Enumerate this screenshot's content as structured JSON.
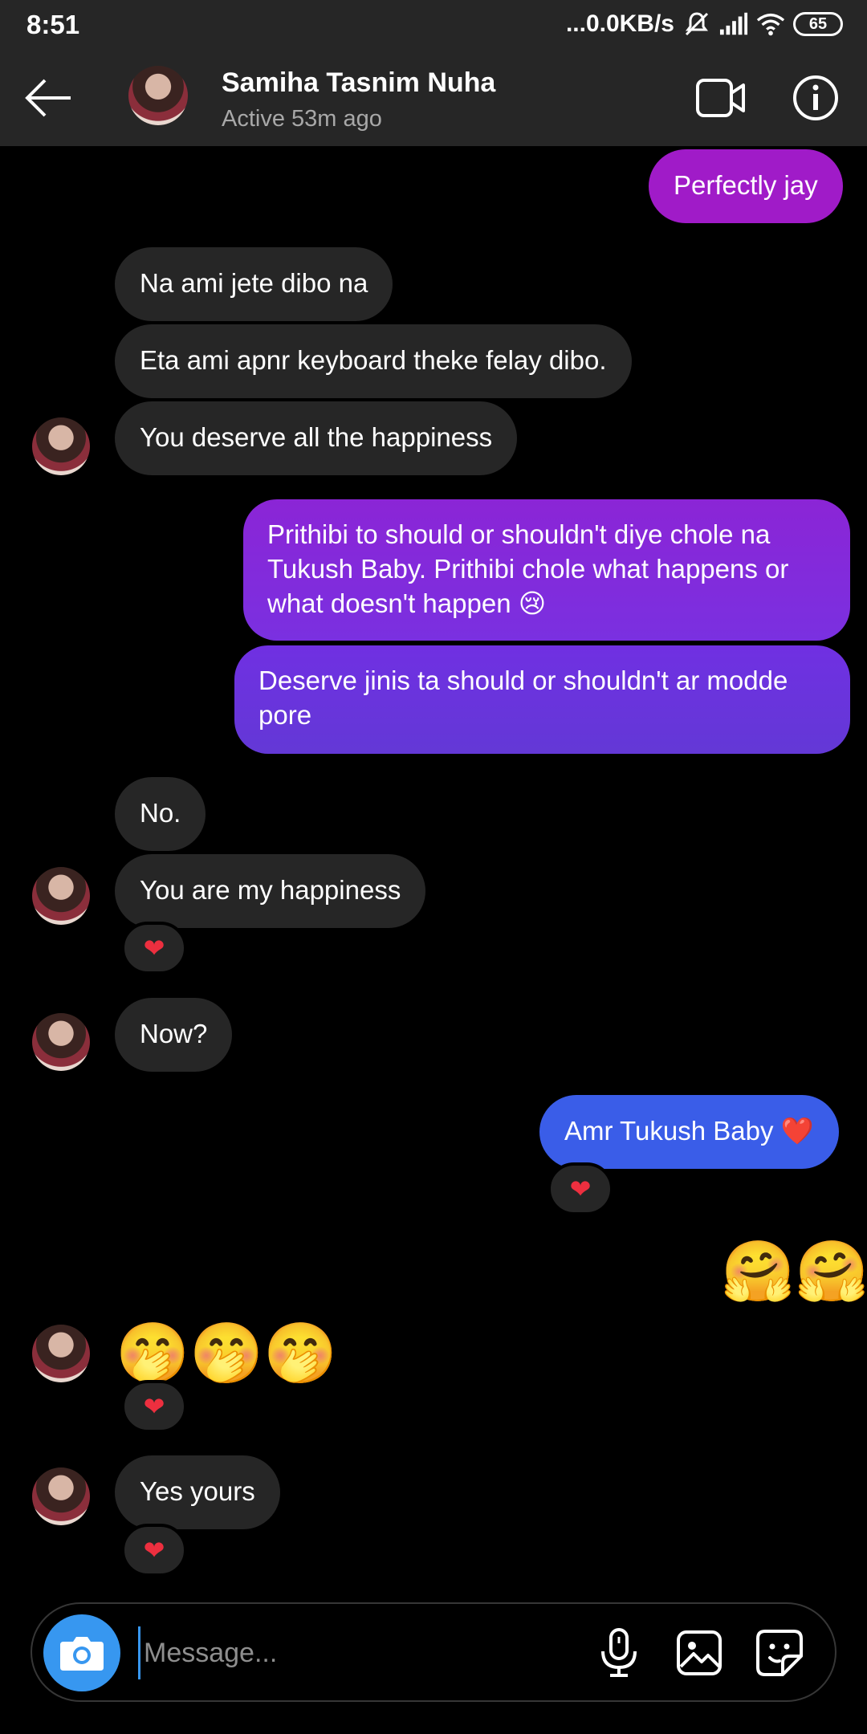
{
  "status_bar": {
    "time": "8:51",
    "network_speed": "...0.0KB/s",
    "battery": "65"
  },
  "header": {
    "contact_name": "Samiha Tasnim Nuha",
    "contact_status": "Active 53m ago"
  },
  "messages": [
    {
      "side": "out",
      "text": "Perfectly jay"
    },
    {
      "side": "in",
      "text": "Na ami jete dibo na"
    },
    {
      "side": "in",
      "text": "Eta ami apnr keyboard theke felay dibo."
    },
    {
      "side": "in",
      "text": "You deserve all the happiness"
    },
    {
      "side": "out",
      "text": "Prithibi to should or shouldn't diye chole na Tukush Baby. Prithibi chole what happens or what doesn't happen 😢"
    },
    {
      "side": "out",
      "text": "Deserve jinis ta should or shouldn't ar modde pore"
    },
    {
      "side": "in",
      "text": "No."
    },
    {
      "side": "in",
      "text": "You are my happiness",
      "reaction": "❤"
    },
    {
      "side": "in",
      "text": "Now?"
    },
    {
      "side": "out",
      "text": "Amr Tukush Baby ❤️",
      "reaction": "❤"
    },
    {
      "side": "out",
      "text": "🤗🤗"
    },
    {
      "side": "in",
      "text": "🤭🤭🤭",
      "reaction": "❤"
    },
    {
      "side": "in",
      "text": "Yes yours",
      "reaction": "❤"
    }
  ],
  "composer": {
    "placeholder": "Message..."
  },
  "colors": {
    "bubble_in": "#262626",
    "bubble_out_purple": "#a01bc8",
    "bubble_out_violet": "#7c2ee6",
    "bubble_out_blue": "#3a5de8",
    "camera_button": "#3797f0",
    "reaction_heart": "#ed2f3f"
  },
  "icons": {
    "back": "arrow-left-icon",
    "video": "video-camera-icon",
    "info": "info-circle-icon",
    "camera": "camera-icon",
    "mic": "microphone-icon",
    "gallery": "image-icon",
    "sticker": "sticker-icon"
  }
}
